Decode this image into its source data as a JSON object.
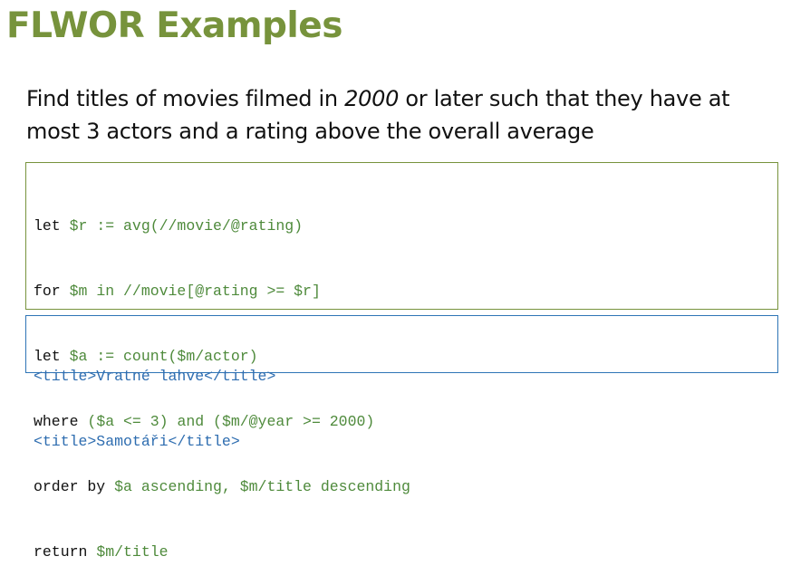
{
  "slide": {
    "title": "FLWOR Examples"
  },
  "task": {
    "line1_before": "Find titles of movies filmed in ",
    "line1_year": "2000",
    "line1_after": " or later such that they have at",
    "line2": "most 3 actors and a rating above the overall average"
  },
  "query": {
    "lines": [
      {
        "keyword": "let ",
        "expr": "$r := avg(//movie/@rating)"
      },
      {
        "keyword": "for ",
        "expr": "$m in //movie[@rating >= $r]"
      },
      {
        "keyword": "let ",
        "expr": "$a := count($m/actor)"
      },
      {
        "keyword": "where ",
        "expr": "($a <= 3) and ($m/@year >= 2000)"
      },
      {
        "keyword": "order by ",
        "expr": "$a ascending, $m/title descending"
      },
      {
        "keyword": "return ",
        "expr": "$m/title"
      }
    ]
  },
  "result": {
    "lines": [
      "<title>Vratné lahve</title>",
      "<title>Samotáři</title>"
    ]
  },
  "colors": {
    "title": "#77933c",
    "query_border": "#77933c",
    "query_expr": "#4e8a3b",
    "result_border": "#2e75b6",
    "result_text": "#2e6db0"
  }
}
